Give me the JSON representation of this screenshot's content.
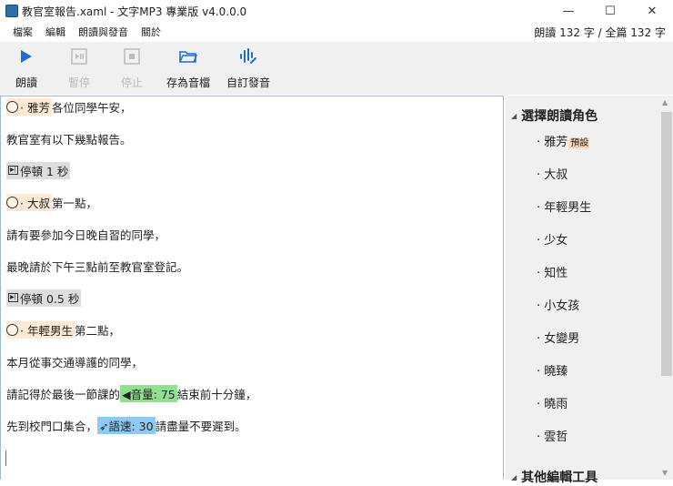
{
  "window": {
    "title": "教官室報告.xaml - 文字MP3 專業版 v4.0.0.0",
    "minimize": "—",
    "maximize": "☐",
    "close": "✕"
  },
  "menu": [
    "檔案",
    "編輯",
    "朗讀與發音",
    "關於"
  ],
  "counter": "朗讀 132 字 / 全篇 132 字",
  "toolbar": {
    "read": "朗讀",
    "pause": "暫停",
    "stop": "停止",
    "save": "存為音檔",
    "custom": "自訂發音"
  },
  "editor": {
    "l1_role": "· 雅芳",
    "l1_text": "各位同學午安，",
    "l2": "教官室有以下幾點報告。",
    "l3_pause": "停頓 1 秒",
    "l4_role": "· 大叔",
    "l4_text": "第一點，",
    "l5": "請有要參加今日晚自習的同學，",
    "l6": "最晚請於下午三點前至教官室登記。",
    "l7_pause": "停頓 0.5 秒",
    "l8_role": "· 年輕男生",
    "l8_text": "第二點，",
    "l9": "本月從事交通導護的同學，",
    "l10_a": "請記得於最後一節課的",
    "l10_vol": "音量: 75",
    "l10_b": "結束前十分鐘，",
    "l11_a": "先到校門口集合，",
    "l11_spd": "語速: 30",
    "l11_b": "請盡量不要遲到。"
  },
  "side": {
    "header": "選擇朗讀角色",
    "default_tag": "預設",
    "roles": [
      "· 雅芳",
      "· 大叔",
      "· 年輕男生",
      "· 少女",
      "· 知性",
      "· 小女孩",
      "· 女變男",
      "· 曉臻",
      "· 曉雨",
      "· 雲哲"
    ],
    "header2": "其他編輯工具"
  },
  "colors": {
    "accent": "#1e6fd0",
    "role_bg": "#fde9d4",
    "volume_bg": "#8fe08f",
    "speed_bg": "#8ccaf4"
  }
}
